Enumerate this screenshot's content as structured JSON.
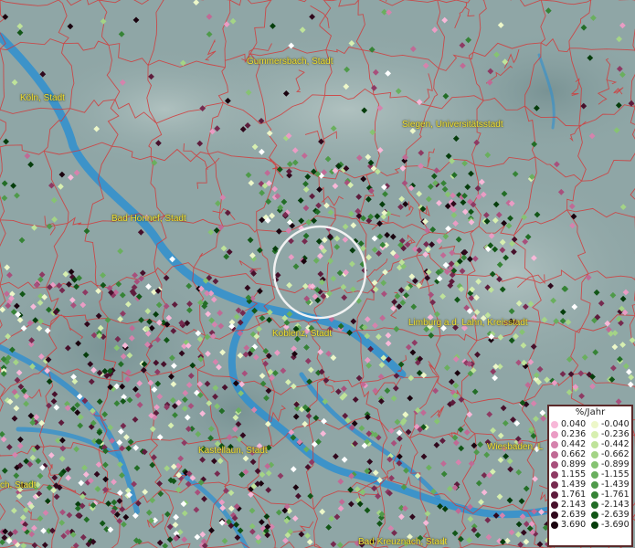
{
  "map": {
    "colors": {
      "terrain": "#8fa6a6",
      "water": "#2f8fcf",
      "borders": "#d23a3a",
      "city_label": "#f2e23a"
    },
    "cities": [
      "Gummersbach, Stadt",
      "Köln, Stadt",
      "Siegen, Universitätsstadt",
      "Bad Honnef, Stadt",
      "Limburg a.d. Lahn, Kreisstadt",
      "Koblenz, Stadt",
      "Kastellaun, Stadt",
      "Wiesbaden, L",
      "ch, Stadt",
      "Bad Kreuznach, Stadt"
    ],
    "marker_colors": {
      "positive": [
        "#f7b8d8",
        "#ea9cc4",
        "#d583ad",
        "#c06a95",
        "#a8507c",
        "#8e3a63",
        "#762a4f",
        "#5e1c3c",
        "#47102b",
        "#30081c",
        "#1a030e"
      ],
      "negative": [
        "#edf7c9",
        "#d7efb0",
        "#bfe39a",
        "#a4d486",
        "#86c372",
        "#6aaf5e",
        "#4f9a4a",
        "#368336",
        "#226d26",
        "#125617",
        "#063d0c"
      ]
    },
    "highlight": "circle-marker"
  },
  "legend": {
    "title": "%/Jahr",
    "positive": [
      "0.040",
      "0.236",
      "0.442",
      "0.662",
      "0.899",
      "1.155",
      "1.439",
      "1.761",
      "2.143",
      "2.639",
      "3.690"
    ],
    "negative": [
      "-0.040",
      "-0.236",
      "-0.442",
      "-0.662",
      "-0.899",
      "-1.155",
      "-1.439",
      "-1.761",
      "-2.143",
      "-2.639",
      "-3.690"
    ]
  }
}
